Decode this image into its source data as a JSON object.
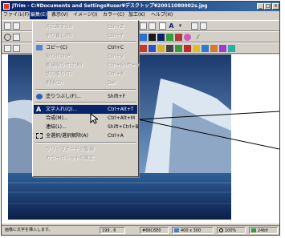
{
  "window": {
    "title": "JTrim - C:¥Documents and Settings¥user¥デスクトップ¥20011080002s.jpg",
    "controls": [
      "_",
      "□",
      "×"
    ]
  },
  "menubar": {
    "items": [
      "ファイル(F)",
      "編集(E)",
      "表示(V)",
      "イメージ(I)",
      "カラー(C)",
      "加工(K)",
      "ヘルプ(H)"
    ]
  },
  "edit_menu": {
    "items": [
      {
        "label": "元に戻す(U)",
        "shortcut": "Ctrl+Z",
        "enabled": false
      },
      {
        "label": "やり直し(R)",
        "shortcut": "Ctrl+Y",
        "enabled": false
      },
      {
        "label": "コピー(C)",
        "shortcut": "Ctrl+C",
        "enabled": true
      },
      {
        "label": "貼り付け(P)",
        "shortcut": "Ctrl+V",
        "enabled": false
      },
      {
        "label": "新規貼り付け(N)",
        "shortcut": "Ctrl+Shift+V",
        "enabled": false
      },
      {
        "label": "切り取り(T)",
        "shortcut": "Ctrl+X",
        "enabled": false
      },
      {
        "label": "削除(D)",
        "shortcut": "Del",
        "enabled": false
      },
      {
        "label": "塗りつぶし(F)...",
        "shortcut": "Shift+F",
        "enabled": true
      },
      {
        "label": "文字入れ(Q)...",
        "shortcut": "Ctrl+Alt+T",
        "enabled": true,
        "highlighted": true
      },
      {
        "label": "合成(M)...",
        "shortcut": "Ctrl+Alt+M",
        "enabled": true
      },
      {
        "label": "連結(L)...",
        "shortcut": "Shift+Ctrl+B",
        "enabled": true
      },
      {
        "label": "全選択/選択解除(A)",
        "shortcut": "Ctrl+A",
        "enabled": true
      },
      {
        "label": "クリップボードの監視",
        "shortcut": "",
        "enabled": false
      },
      {
        "label": "カラーパレットの設定",
        "shortcut": "",
        "enabled": false
      }
    ]
  },
  "statusbar": {
    "message": "画像に文字を挿入します。",
    "coords": "199 , 6",
    "color": "#66C6E0",
    "size": "400 x 300",
    "zoom": "100%",
    "bits": "24bit"
  },
  "colors": {
    "title_gradient_start": "#0a246a",
    "title_gradient_end": "#3a6ea5",
    "highlight": "#0a246a",
    "chrome": "#d4d0c8"
  }
}
